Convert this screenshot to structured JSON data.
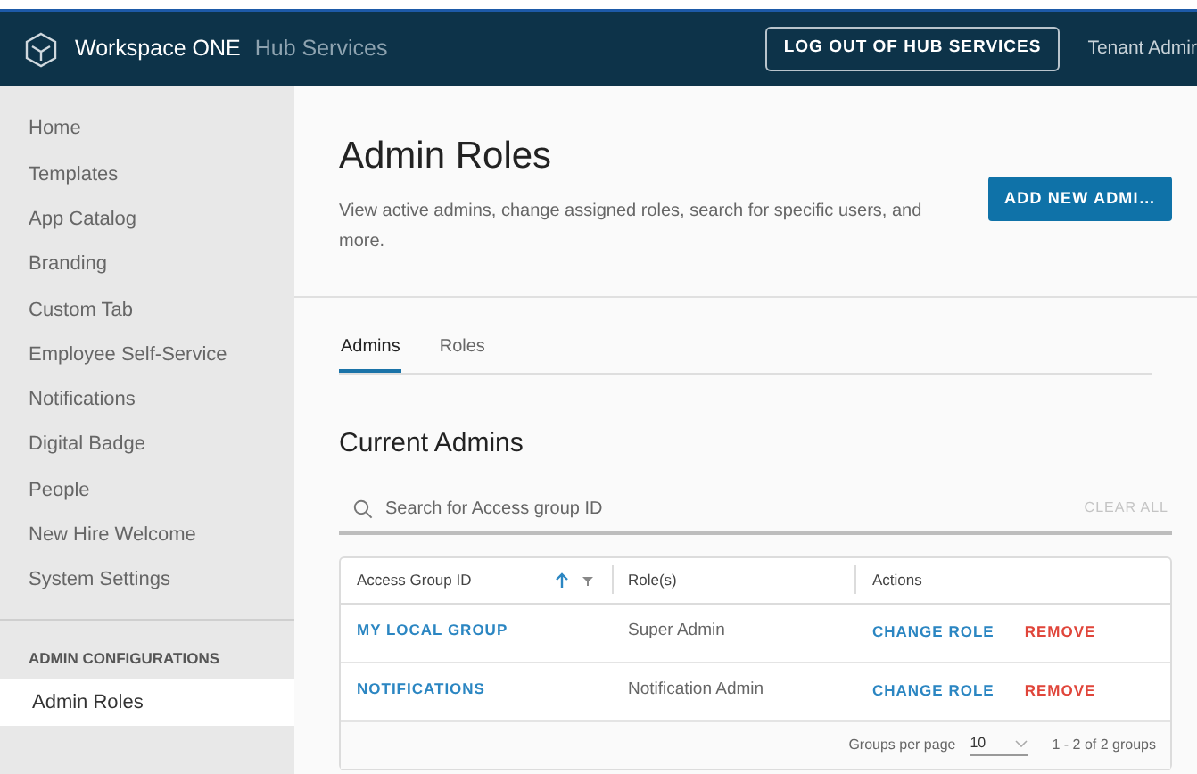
{
  "header": {
    "brand": "Workspace ONE",
    "product": "Hub Services",
    "logout_button": "LOG OUT OF HUB SERVICES",
    "user": "Tenant Admir"
  },
  "sidebar": {
    "items": [
      {
        "label": "Home",
        "selected": false
      },
      {
        "label": "Templates",
        "selected": false
      },
      {
        "label": "App Catalog",
        "selected": false
      },
      {
        "label": "Branding",
        "selected": false
      },
      {
        "label": "Custom Tab",
        "selected": false
      },
      {
        "label": "Employee Self-Service",
        "selected": false
      },
      {
        "label": "Notifications",
        "selected": false
      },
      {
        "label": "Digital Badge",
        "selected": false
      },
      {
        "label": "People",
        "selected": false
      },
      {
        "label": "New Hire Welcome",
        "selected": false
      },
      {
        "label": "System Settings",
        "selected": false
      }
    ],
    "section": {
      "heading": "ADMIN CONFIGURATIONS",
      "items": [
        {
          "label": "Admin Roles",
          "selected": true
        }
      ]
    }
  },
  "page": {
    "title": "Admin Roles",
    "description": "View active admins, change assigned roles, search for specific users, and more.",
    "add_button": "ADD NEW ADMI…"
  },
  "tabs": [
    {
      "label": "Admins",
      "selected": true
    },
    {
      "label": "Roles",
      "selected": false
    }
  ],
  "section_title": "Current Admins",
  "search": {
    "placeholder": "Search for Access group ID",
    "clear": "CLEAR ALL"
  },
  "table": {
    "columns": [
      "Access Group ID",
      "Role(s)",
      "Actions"
    ],
    "rows": [
      {
        "group": "MY LOCAL GROUP",
        "role": "Super Admin",
        "change": "CHANGE ROLE",
        "remove": "REMOVE"
      },
      {
        "group": "NOTIFICATIONS",
        "role": "Notification Admin",
        "change": "CHANGE ROLE",
        "remove": "REMOVE"
      }
    ]
  },
  "footer": {
    "per_page_label": "Groups per page",
    "per_page": "10",
    "range": "1 - 2 of 2 groups"
  }
}
